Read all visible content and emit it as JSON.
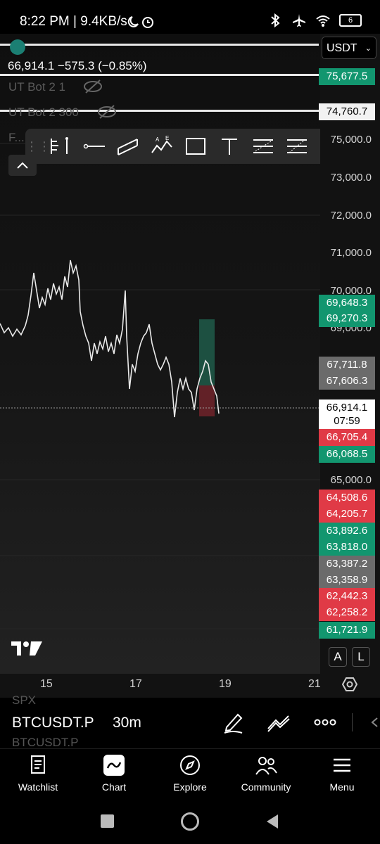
{
  "status": {
    "time_speed": "8:22 PM | 9.4KB/s",
    "battery": "6"
  },
  "header": {
    "currency": "USDT",
    "price_line": "66,914.1  −575.3 (−0.85%)",
    "indicators": [
      "UT Bot 2 1",
      "UT Bot 2 300",
      "F..."
    ]
  },
  "axis": {
    "ticks": [
      "75,000.0",
      "73,000.0",
      "72,000.0",
      "71,000.0",
      "70,000.0",
      "69,000.0",
      "65,000.0"
    ],
    "tags": [
      {
        "label": "75,677.5",
        "color": "green"
      },
      {
        "label": "74,760.7",
        "color": "white"
      },
      {
        "label": "69,648.3",
        "color": "green"
      },
      {
        "label": "69,270.3",
        "color": "green"
      },
      {
        "label": "67,711.8",
        "color": "gray"
      },
      {
        "label": "67,606.3",
        "color": "gray"
      },
      {
        "label": "66,914.1",
        "color": "white"
      },
      {
        "label": "07:59",
        "color": "white"
      },
      {
        "label": "66,705.4",
        "color": "red"
      },
      {
        "label": "66,068.5",
        "color": "green"
      },
      {
        "label": "64,508.6",
        "color": "red"
      },
      {
        "label": "64,205.7",
        "color": "red"
      },
      {
        "label": "63,892.6",
        "color": "green"
      },
      {
        "label": "63,818.0",
        "color": "green"
      },
      {
        "label": "63,387.2",
        "color": "gray"
      },
      {
        "label": "63,358.9",
        "color": "gray"
      },
      {
        "label": "62,442.3",
        "color": "red"
      },
      {
        "label": "62,258.2",
        "color": "red"
      },
      {
        "label": "61,721.9",
        "color": "green"
      }
    ]
  },
  "x_axis": {
    "dates": [
      "15",
      "17",
      "19",
      "21"
    ]
  },
  "scale_buttons": {
    "a": "A",
    "l": "L"
  },
  "symbol_bar": {
    "symbol": "BTCUSDT.P",
    "interval": "30m",
    "above": "SPX",
    "below": "BTCUSDT.P"
  },
  "nav": {
    "items": [
      "Watchlist",
      "Chart",
      "Explore",
      "Community",
      "Menu"
    ]
  }
}
